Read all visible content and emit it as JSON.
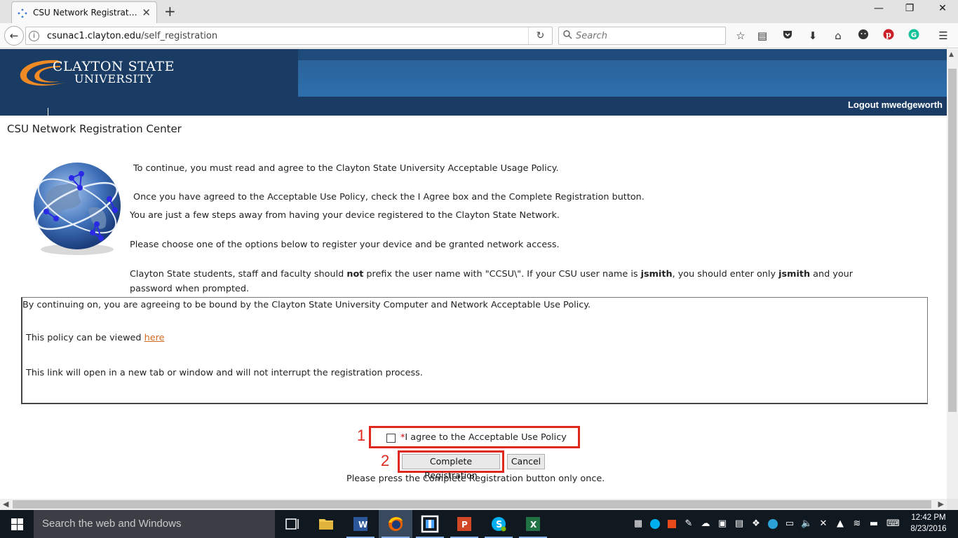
{
  "browser": {
    "tab_title": "CSU Network Registration ...",
    "tab_close": "✕",
    "new_tab": "+",
    "url_host": "csunac1.clayton.edu",
    "url_path": "/self_registration",
    "search_placeholder": "Search",
    "window_controls": {
      "minimize": "—",
      "restore": "❐",
      "close": "✕"
    }
  },
  "site": {
    "logo_line1": "CLAYTON STATE",
    "logo_line2": "UNIVERSITY",
    "logout": "Logout mwedgeworth",
    "page_title": "CSU Network Registration Center"
  },
  "content": {
    "intro1": "To continue, you must read and agree to the Clayton State University Acceptable Usage Policy.",
    "intro2": "Once you have agreed to the Acceptable Use Policy, check the I Agree box and the Complete Registration button.",
    "intro3": "You are just a few steps away from having your device registered to the Clayton State Network.",
    "intro4": "Please choose one of the options below to register your device and be granted network access.",
    "intro5_a": "Clayton State students, staff and faculty should ",
    "intro5_not": "not",
    "intro5_b": " prefix the user name with \"CCSU\\\". If your CSU user name is ",
    "intro5_jsmith1": "jsmith",
    "intro5_c": ", you should enter only ",
    "intro5_jsmith2": "jsmith",
    "intro5_d": " and your",
    "intro5_line2": "password when prompted.",
    "policy_line1": "By continuing on, you are agreeing to be bound by the Clayton State University Computer and Network Acceptable Use Policy.",
    "policy_line2": "This policy can be viewed ",
    "policy_link": "here",
    "policy_line3": "This link will open in a new tab or window and will not interrupt the registration process."
  },
  "form": {
    "agree_required": "*",
    "agree_label": "I agree to the Acceptable Use Policy",
    "complete_label": "Complete Registration",
    "cancel_label": "Cancel",
    "note": "Please press the Complete Registration button only once.",
    "step1": "1",
    "step2": "2"
  },
  "taskbar": {
    "search_placeholder": "Search the web and Windows",
    "time": "12:42 PM",
    "date": "8/23/2016"
  },
  "colors": {
    "banner": "#1a3c64",
    "highlight": "#e0281e",
    "link": "#d2691e"
  }
}
